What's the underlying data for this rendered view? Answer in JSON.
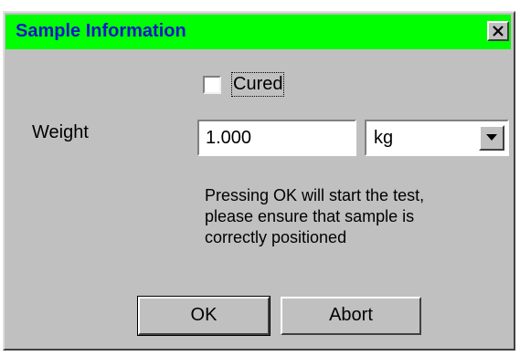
{
  "window": {
    "title": "Sample Information",
    "title_bar_color": "#00ff00",
    "title_text_color": "#1515c8",
    "close_icon": "close-icon"
  },
  "form": {
    "cured_checkbox": {
      "label": "Cured",
      "checked": false
    },
    "weight": {
      "label": "Weight",
      "value": "1.000"
    },
    "unit": {
      "selected": "kg",
      "arrow_icon": "chevron-down-icon"
    },
    "message_lines": [
      "Pressing OK will start the test,",
      "please ensure that sample is",
      "correctly positioned"
    ]
  },
  "buttons": {
    "ok_label": "OK",
    "abort_label": "Abort"
  }
}
